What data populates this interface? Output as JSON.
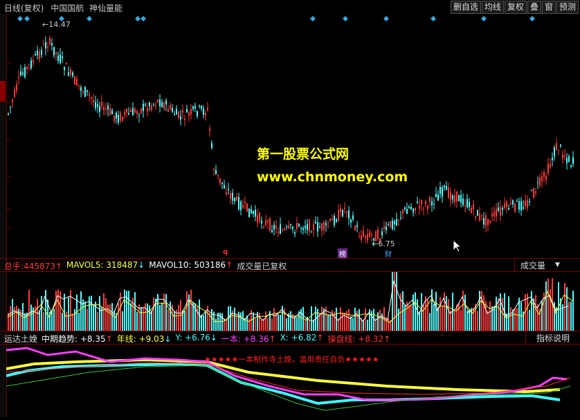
{
  "title": {
    "period": "日线(复权)",
    "stock": "中国国航",
    "indicator": "神仙量能"
  },
  "toolbar": [
    "删自选",
    "均线",
    "复权",
    "叠",
    "窗",
    "预测"
  ],
  "price": {
    "high_label": "14.47",
    "low_label": "6.75",
    "marker_q": "q",
    "marker_bang": "榜",
    "marker_cai": "财"
  },
  "watermark": {
    "line1": "第一股票公式网",
    "line2": "www.chnmoney.com"
  },
  "volume_header": {
    "total_label": "总手:",
    "total_value": "445873",
    "total_arrow": "↑",
    "mavol5_label": "MAVOL5:",
    "mavol5_value": "318487",
    "mavol5_arrow": "↓",
    "mavol10_label": "MAVOL10:",
    "mavol10_value": "503186",
    "mavol10_arrow": "↑",
    "note": "成交量已复权",
    "dropdown": "成交量"
  },
  "indicator_header": {
    "name": "运达土娩",
    "items": [
      {
        "label": "中期趋势:",
        "value": "+8.35",
        "arrow": "↑",
        "color": "#ffffff"
      },
      {
        "label": "年线:",
        "value": "+9.03",
        "arrow": "↓",
        "color": "#ffff40"
      },
      {
        "label": "Y:",
        "value": "+6.76",
        "arrow": "↓",
        "color": "#40ffff"
      },
      {
        "label": "一本:",
        "value": "+8.36",
        "arrow": "↑",
        "color": "#ff40ff"
      },
      {
        "label": "X:",
        "value": "+6.82",
        "arrow": "↑",
        "color": "#40ffff"
      },
      {
        "label": "操盘线:",
        "value": "+8.32",
        "arrow": "↑",
        "color": "#ff3030"
      }
    ],
    "help": "指标说明"
  },
  "indicator_notice": "★★★★★一本制作寺土娩，滥用责任自负★★★★★",
  "colors": {
    "up": "#ff3c3c",
    "down": "#54ffff",
    "border": "#7a0000",
    "diamond": "#3aa7e0"
  }
}
